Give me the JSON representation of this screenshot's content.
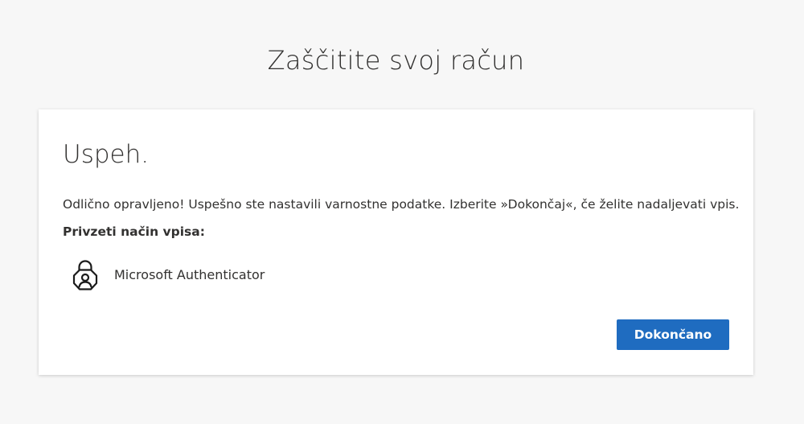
{
  "page": {
    "title": "Zaščitite svoj račun"
  },
  "card": {
    "heading": "Uspeh.",
    "message": "Odlično opravljeno! Uspešno ste nastavili varnostne podatke. Izberite »Dokončaj«, če želite nadaljevati vpis.",
    "default_method_label": "Privzeti način vpisa:",
    "method": {
      "name": "Microsoft Authenticator",
      "icon": "authenticator-lock-icon"
    },
    "done_button_label": "Dokončano"
  },
  "colors": {
    "background": "#f7f7f7",
    "card": "#ffffff",
    "primary_button": "#1f6cc0",
    "text": "#323130"
  }
}
